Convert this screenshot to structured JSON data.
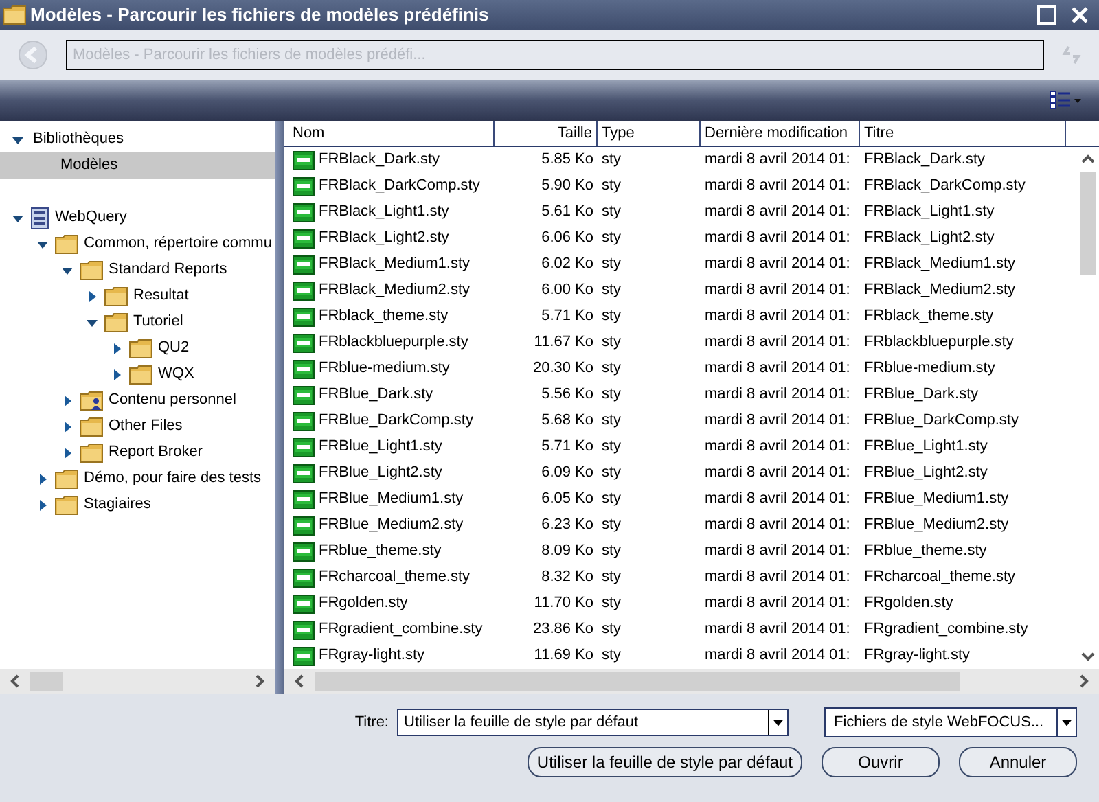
{
  "window": {
    "title": "Modèles - Parcourir les fichiers de modèles prédéfinis"
  },
  "address_bar": {
    "text": "Modèles - Parcourir les fichiers de modèles prédéfi..."
  },
  "sidebar": {
    "libraries": {
      "label": "Bibliothèques",
      "expanded": true,
      "items": [
        {
          "label": "Modèles",
          "selected": true
        }
      ]
    },
    "tree": [
      {
        "label": "WebQuery",
        "kind": "server",
        "expanded": true,
        "children": [
          {
            "label": "Common, répertoire commu",
            "kind": "folder",
            "expanded": true,
            "children": [
              {
                "label": "Standard Reports",
                "kind": "folder",
                "expanded": true,
                "children": [
                  {
                    "label": "Resultat",
                    "kind": "folder",
                    "expanded": false
                  },
                  {
                    "label": "Tutoriel",
                    "kind": "folder",
                    "expanded": true,
                    "children": [
                      {
                        "label": "QU2",
                        "kind": "folder",
                        "expanded": false
                      },
                      {
                        "label": "WQX",
                        "kind": "folder",
                        "expanded": false
                      }
                    ]
                  }
                ]
              },
              {
                "label": "Contenu personnel",
                "kind": "user-folder",
                "expanded": false
              },
              {
                "label": "Other Files",
                "kind": "folder",
                "expanded": false
              },
              {
                "label": "Report Broker",
                "kind": "folder",
                "expanded": false
              }
            ]
          },
          {
            "label": "Démo, pour faire des tests",
            "kind": "folder",
            "expanded": false
          },
          {
            "label": "Stagiaires",
            "kind": "folder",
            "expanded": false
          }
        ]
      }
    ]
  },
  "table": {
    "columns": [
      "Nom",
      "Taille",
      "Type",
      "Dernière modification",
      "Titre"
    ],
    "rows": [
      [
        "FRBlack_Dark.sty",
        "5.85 Ko",
        "sty",
        "mardi 8 avril 2014 01:",
        "FRBlack_Dark.sty"
      ],
      [
        "FRBlack_DarkComp.sty",
        "5.90 Ko",
        "sty",
        "mardi 8 avril 2014 01:",
        "FRBlack_DarkComp.sty"
      ],
      [
        "FRBlack_Light1.sty",
        "5.61 Ko",
        "sty",
        "mardi 8 avril 2014 01:",
        "FRBlack_Light1.sty"
      ],
      [
        "FRBlack_Light2.sty",
        "6.06 Ko",
        "sty",
        "mardi 8 avril 2014 01:",
        "FRBlack_Light2.sty"
      ],
      [
        "FRBlack_Medium1.sty",
        "6.02 Ko",
        "sty",
        "mardi 8 avril 2014 01:",
        "FRBlack_Medium1.sty"
      ],
      [
        "FRBlack_Medium2.sty",
        "6.00 Ko",
        "sty",
        "mardi 8 avril 2014 01:",
        "FRBlack_Medium2.sty"
      ],
      [
        "FRblack_theme.sty",
        "5.71 Ko",
        "sty",
        "mardi 8 avril 2014 01:",
        "FRblack_theme.sty"
      ],
      [
        "FRblackbluepurple.sty",
        "11.67 Ko",
        "sty",
        "mardi 8 avril 2014 01:",
        "FRblackbluepurple.sty"
      ],
      [
        "FRblue-medium.sty",
        "20.30 Ko",
        "sty",
        "mardi 8 avril 2014 01:",
        "FRblue-medium.sty"
      ],
      [
        "FRBlue_Dark.sty",
        "5.56 Ko",
        "sty",
        "mardi 8 avril 2014 01:",
        "FRBlue_Dark.sty"
      ],
      [
        "FRBlue_DarkComp.sty",
        "5.68 Ko",
        "sty",
        "mardi 8 avril 2014 01:",
        "FRBlue_DarkComp.sty"
      ],
      [
        "FRBlue_Light1.sty",
        "5.71 Ko",
        "sty",
        "mardi 8 avril 2014 01:",
        "FRBlue_Light1.sty"
      ],
      [
        "FRBlue_Light2.sty",
        "6.09 Ko",
        "sty",
        "mardi 8 avril 2014 01:",
        "FRBlue_Light2.sty"
      ],
      [
        "FRBlue_Medium1.sty",
        "6.05 Ko",
        "sty",
        "mardi 8 avril 2014 01:",
        "FRBlue_Medium1.sty"
      ],
      [
        "FRBlue_Medium2.sty",
        "6.23 Ko",
        "sty",
        "mardi 8 avril 2014 01:",
        "FRBlue_Medium2.sty"
      ],
      [
        "FRblue_theme.sty",
        "8.09 Ko",
        "sty",
        "mardi 8 avril 2014 01:",
        "FRblue_theme.sty"
      ],
      [
        "FRcharcoal_theme.sty",
        "8.32 Ko",
        "sty",
        "mardi 8 avril 2014 01:",
        "FRcharcoal_theme.sty"
      ],
      [
        "FRgolden.sty",
        "11.70 Ko",
        "sty",
        "mardi 8 avril 2014 01:",
        "FRgolden.sty"
      ],
      [
        "FRgradient_combine.sty",
        "23.86 Ko",
        "sty",
        "mardi 8 avril 2014 01:",
        "FRgradient_combine.sty"
      ],
      [
        "FRgray-light.sty",
        "11.69 Ko",
        "sty",
        "mardi 8 avril 2014 01:",
        "FRgray-light.sty"
      ]
    ]
  },
  "footer": {
    "title_label": "Titre:",
    "title_value": "Utiliser la feuille de style par défaut",
    "filter_value": "Fichiers de style WebFOCUS...",
    "buttons": [
      "Utiliser la feuille de style par défaut",
      "Ouvrir",
      "Annuler"
    ]
  }
}
